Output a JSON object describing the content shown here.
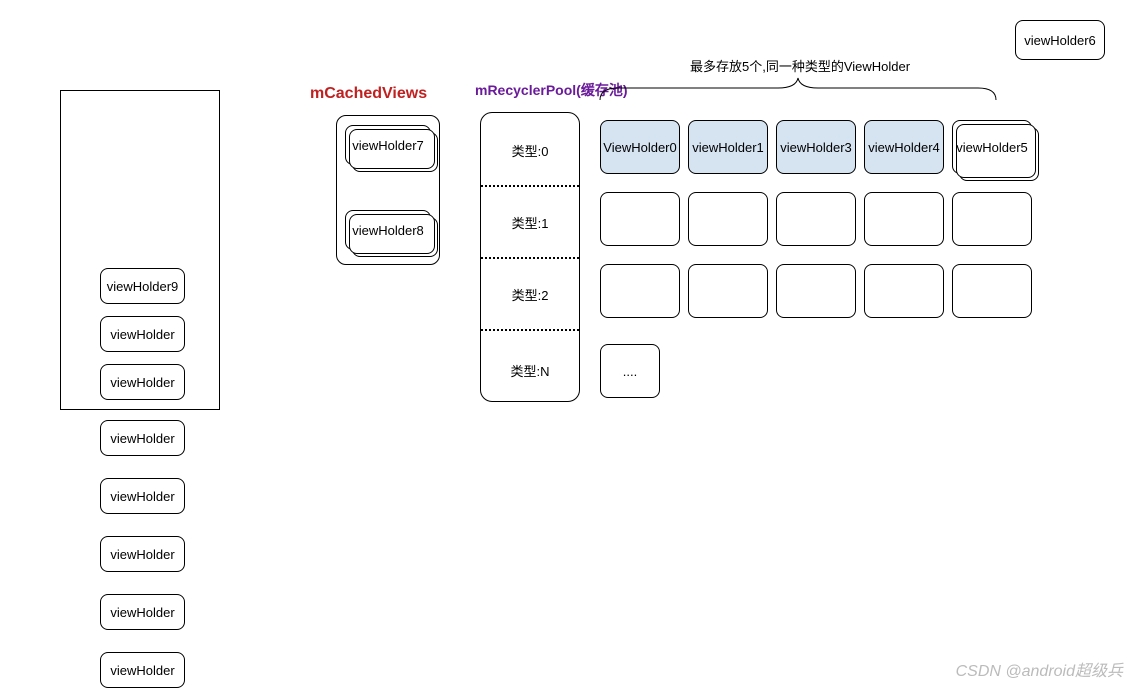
{
  "floating": {
    "vh6": "viewHolder6"
  },
  "leftList": {
    "items": [
      "viewHolder9",
      "viewHolder",
      "viewHolder",
      "viewHolder",
      "viewHolder",
      "viewHolder",
      "viewHolder",
      "viewHolder"
    ]
  },
  "cached": {
    "title": "mCachedViews",
    "items": [
      "viewHolder7",
      "viewHolder8"
    ]
  },
  "pool": {
    "title": "mRecyclerPool(缓存池)",
    "braceNote": "最多存放5个,同一种类型的ViewHolder",
    "types": [
      "类型:0",
      "类型:1",
      "类型:2",
      "类型:N"
    ],
    "row0": [
      "ViewHolder0",
      "viewHolder1",
      "viewHolder3",
      "viewHolder4",
      "viewHolder5"
    ],
    "ellipsis": "...."
  },
  "watermark": "CSDN @android超级兵"
}
